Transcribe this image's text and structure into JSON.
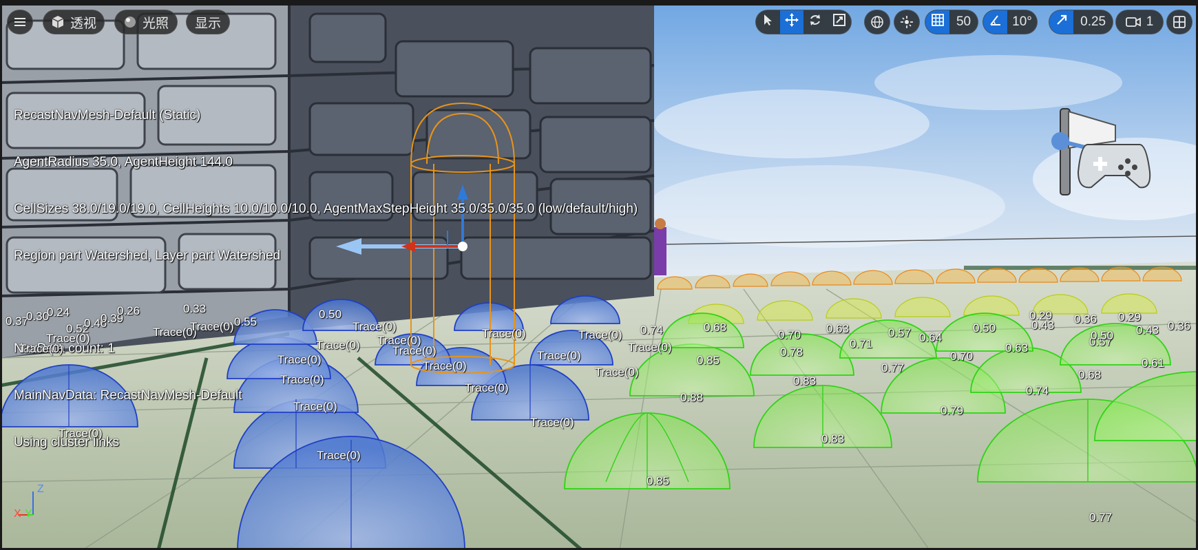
{
  "toolbar": {
    "perspective_label": "透视",
    "lighting_label": "光照",
    "show_label": "显示",
    "grid_snap_value": "50",
    "rotation_snap_value": "10°",
    "scale_snap_value": "0.25",
    "camera_speed_value": "1"
  },
  "navmesh_info": {
    "lines": [
      "RecastNavMesh-Default (Static)",
      "AgentRadius 35.0, AgentHeight 144.0",
      "CellSizes 38.0/19.0/19.0, CellHeights 10.0/10.0/10.0, AgentMaxStepHeight 35.0/35.0/35.0 (low/default/high)",
      "Region part Watershed, Layer part Watershed",
      "",
      "NavData count: 1",
      "MainNavData: RecastNavMesh-Default",
      "Using cluster links"
    ]
  },
  "trace_labels": [
    "Trace(0)",
    "Trace(0)",
    "Trace(0)",
    "Trace(0)",
    "Trace(0)",
    "Trace(0)",
    "Trace(0)",
    "Trace(0)",
    "Trace(0)",
    "Trace(0)",
    "Trace(0)",
    "Trace(0)",
    "Trace(0)",
    "Trace(0)",
    "Trace(0)",
    "Trace(0)",
    "Trace(0)",
    "Trace(0)",
    "Trace(0)",
    "Trace(0)",
    "Trace(0)"
  ],
  "score_labels": [
    "0.85",
    "0.88",
    "0.83",
    "0.83",
    "0.85",
    "0.79",
    "0.77",
    "0.74",
    "0.68",
    "0.70",
    "0.78",
    "0.71",
    "0.63",
    "0.64",
    "0.57",
    "0.50",
    "0.43",
    "0.36",
    "0.29",
    "0.61",
    "0.77",
    "0.74",
    "0.68",
    "0.70",
    "0.63",
    "0.57",
    "0.50",
    "0.43",
    "0.36",
    "0.29",
    "0.37",
    "0.30",
    "0.24",
    "0.52",
    "0.46",
    "0.39",
    "0.33",
    "0.26",
    "0.55",
    "0.50"
  ],
  "axis": {
    "z": "Z",
    "x": "X",
    "y": "Y"
  },
  "colors": {
    "sky_top": "#7fb0e6",
    "floor": "#b8c5a8",
    "wall": "#3a3f4a",
    "blue_dome": "#3a6fd8",
    "green_dome": "#3ee81a",
    "accent": "#1b6fd6"
  }
}
